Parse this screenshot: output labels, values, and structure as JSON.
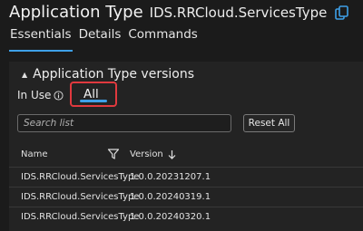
{
  "header": {
    "title": "Application Type",
    "app_name": "IDS.RRCloud.ServicesType",
    "tabs": [
      {
        "label": "Essentials",
        "active": true
      },
      {
        "label": "Details",
        "active": false
      },
      {
        "label": "Commands",
        "active": false
      }
    ]
  },
  "section": {
    "title": "Application Type versions",
    "filter_label": "In Use",
    "filter_value": "All",
    "search_placeholder": "Search list",
    "reset_label": "Reset All"
  },
  "table": {
    "columns": [
      "Name",
      "Version"
    ],
    "sort": "descending",
    "rows": [
      {
        "name": "IDS.RRCloud.ServicesType",
        "version": "1.0.0.20231207.1"
      },
      {
        "name": "IDS.RRCloud.ServicesType",
        "version": "1.0.0.20240319.1"
      },
      {
        "name": "IDS.RRCloud.ServicesType",
        "version": "1.0.0.20240320.1"
      }
    ]
  },
  "colors": {
    "background": "#1b1b1b",
    "panel": "#232323",
    "accent": "#3ea0e8",
    "highlight": "#e0393e",
    "icon": "#3ea0e8"
  },
  "icons": [
    "copy-icon",
    "caret-up-icon",
    "info-icon",
    "filter-icon",
    "sort-down-arrow-icon"
  ]
}
